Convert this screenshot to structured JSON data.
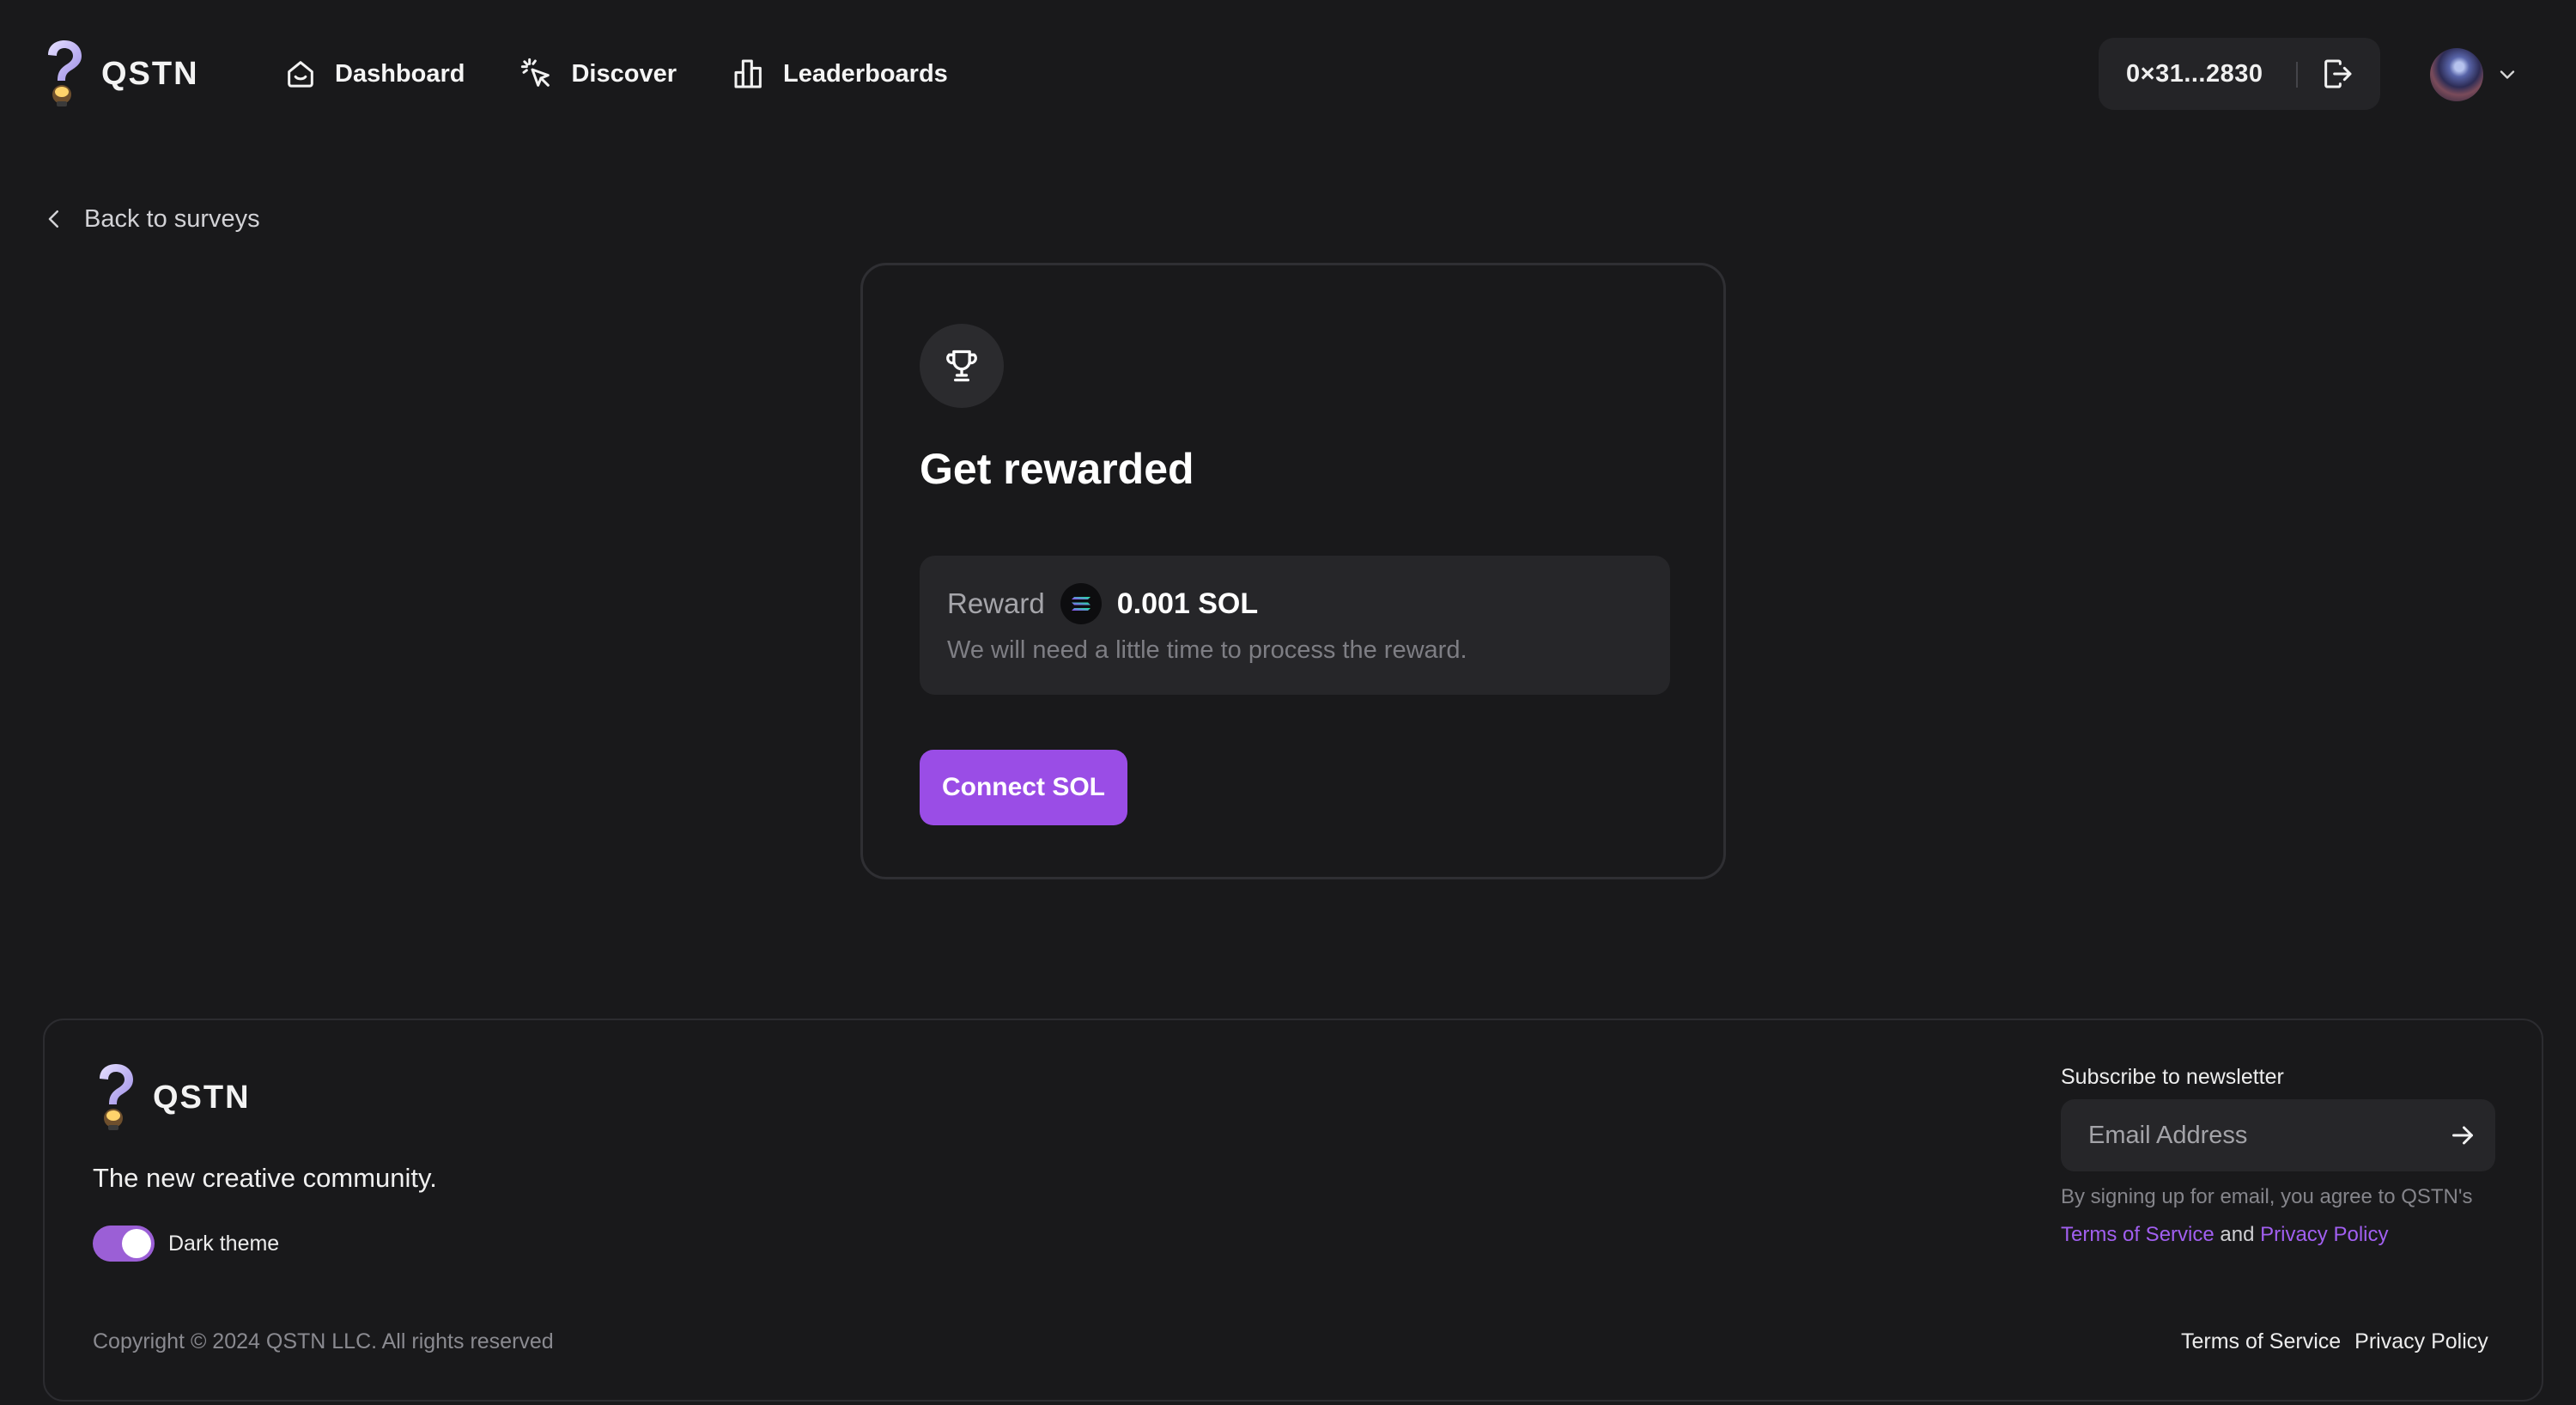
{
  "brand": {
    "name": "QSTN"
  },
  "nav": {
    "items": [
      {
        "label": "Dashboard",
        "icon": "home-icon"
      },
      {
        "label": "Discover",
        "icon": "cursor-click-icon"
      },
      {
        "label": "Leaderboards",
        "icon": "bar-chart-icon"
      }
    ]
  },
  "wallet": {
    "address": "0×31...2830",
    "icon": "logout-icon"
  },
  "back_link": {
    "label": "Back to surveys",
    "icon": "chevron-left-icon"
  },
  "card": {
    "icon": "trophy-icon",
    "title": "Get rewarded",
    "reward": {
      "label": "Reward",
      "token_icon": "solana-icon",
      "amount": "0.001 SOL",
      "note": "We will need a little time to process the reward."
    },
    "button_label": "Connect SOL"
  },
  "footer": {
    "brand": "QSTN",
    "tagline": "The new creative community.",
    "theme_label": "Dark theme",
    "theme_enabled": true,
    "copyright": "Copyright © 2024 QSTN LLC. All rights reserved",
    "newsletter": {
      "title": "Subscribe to newsletter",
      "placeholder": "Email Address",
      "consent_prefix": "By signing up for email, you agree to QSTN's",
      "terms": "Terms of Service",
      "and": "and",
      "privacy": "Privacy Policy"
    },
    "links": {
      "terms": "Terms of Service",
      "privacy": "Privacy Policy"
    }
  },
  "colors": {
    "background": "#19191b",
    "accent": "#9a4de6",
    "link": "#a15ff0",
    "surface": "#262629"
  }
}
